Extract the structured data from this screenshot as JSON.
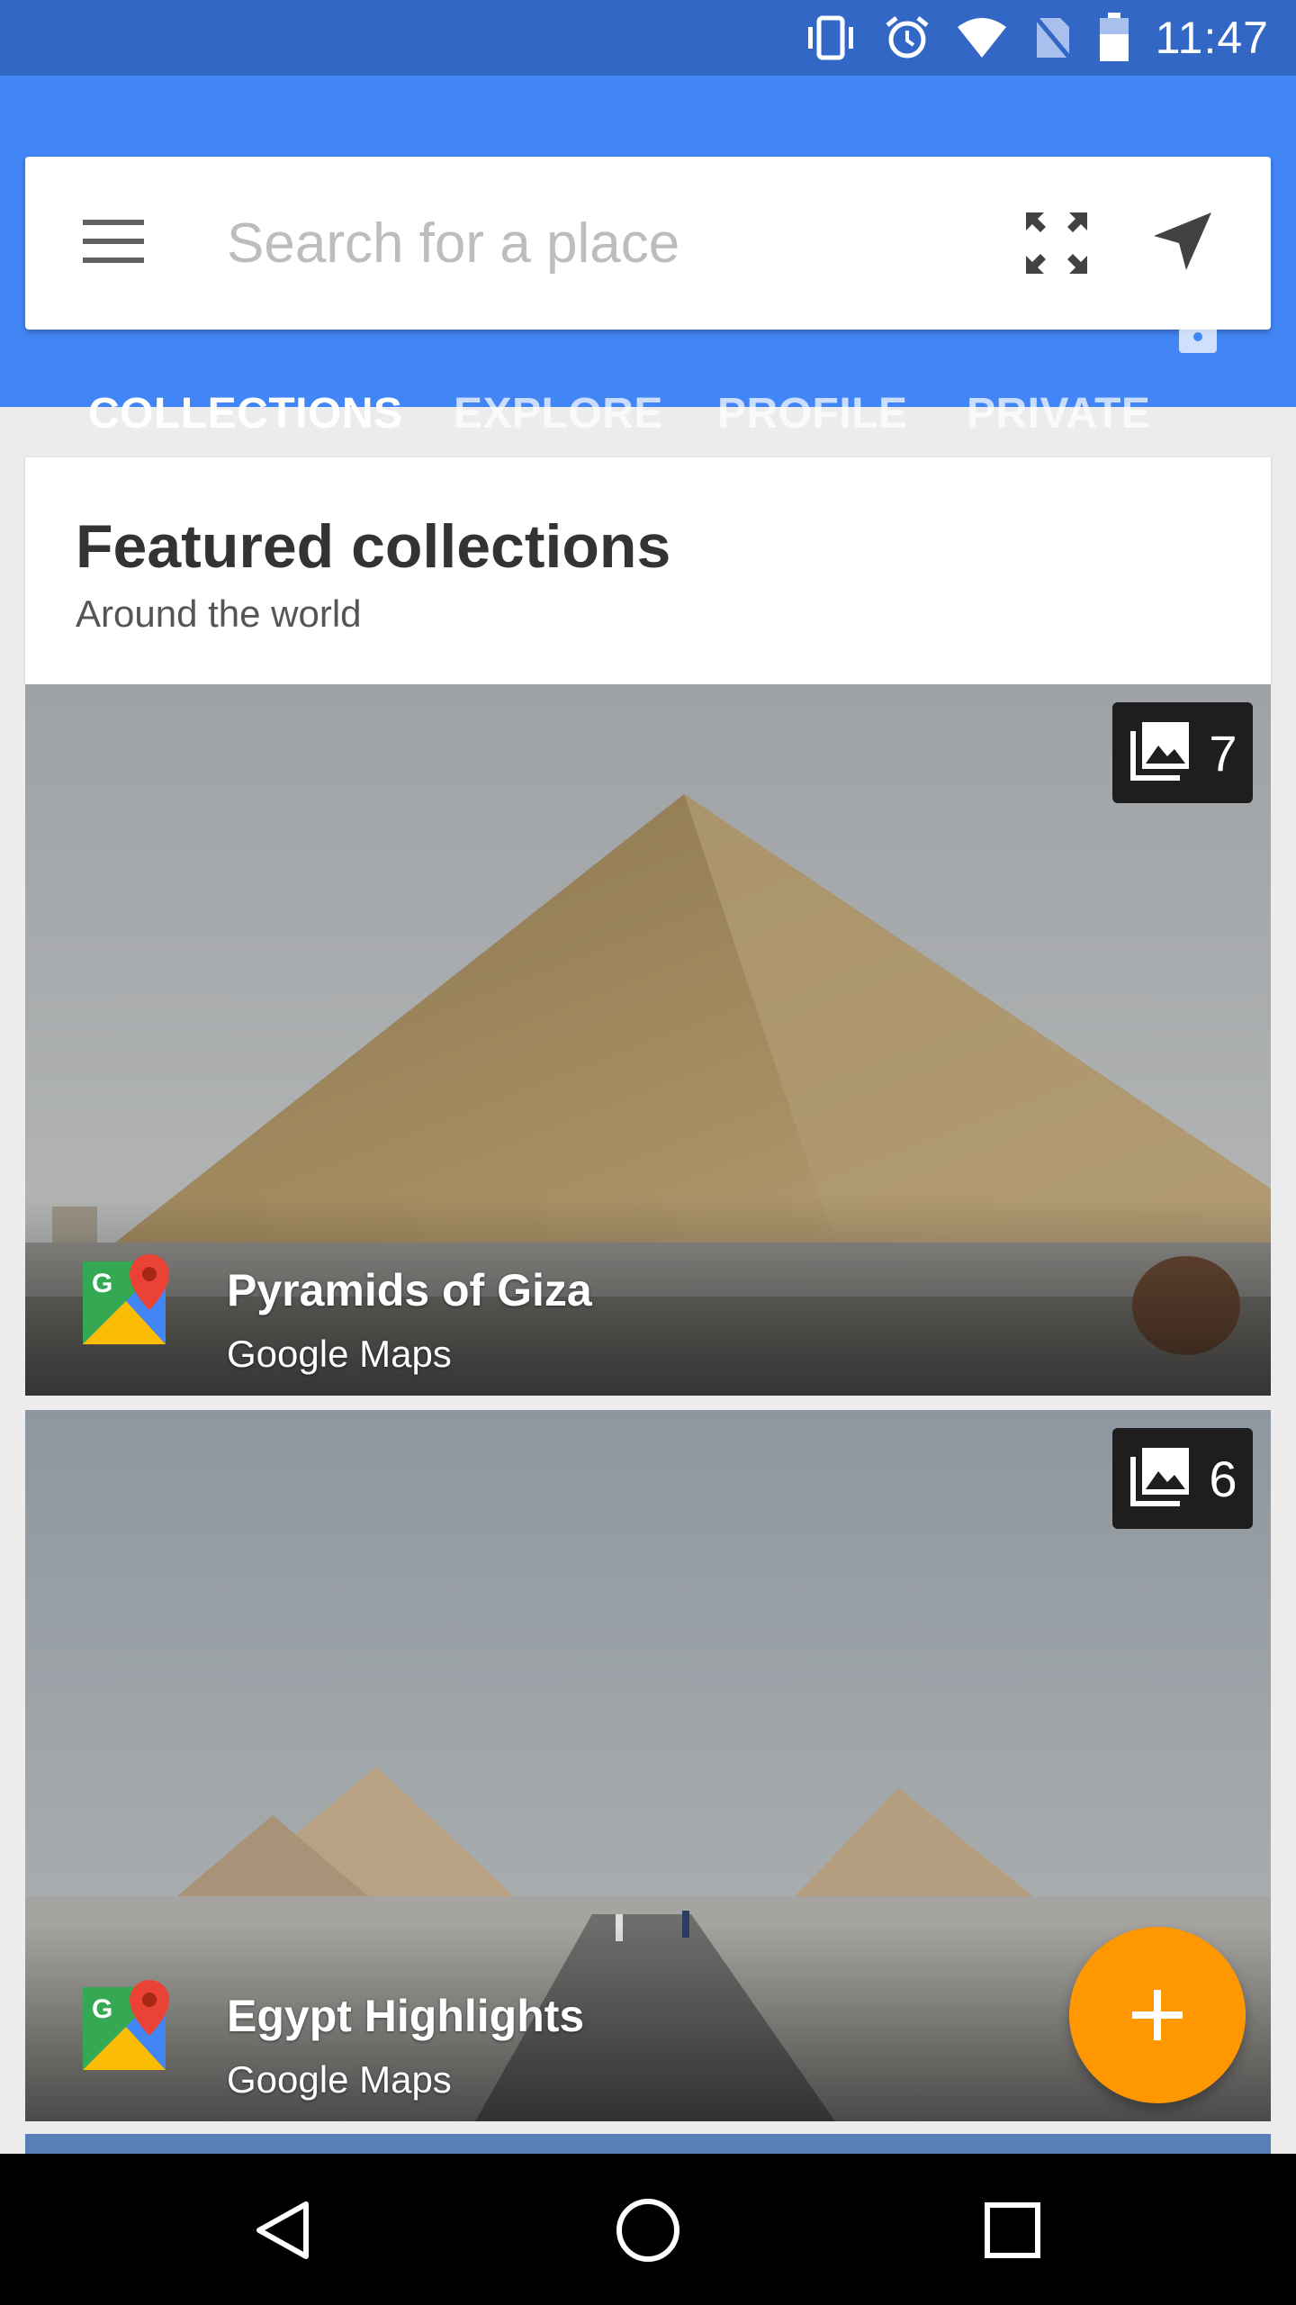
{
  "status_bar": {
    "time": "11:47",
    "icons": [
      "vibrate-icon",
      "alarm-icon",
      "wifi-icon",
      "no-sim-icon",
      "battery-icon"
    ]
  },
  "search": {
    "placeholder": "Search for a place",
    "value": ""
  },
  "tabs": [
    {
      "label": "COLLECTIONS",
      "active": true
    },
    {
      "label": "EXPLORE",
      "active": false
    },
    {
      "label": "PROFILE",
      "active": false
    },
    {
      "label": "PRIVATE",
      "active": false
    }
  ],
  "featured": {
    "title": "Featured collections",
    "subtitle": "Around the world"
  },
  "collections": [
    {
      "title": "Pyramids of Giza",
      "source": "Google Maps",
      "photo_count": "7"
    },
    {
      "title": "Egypt Highlights",
      "source": "Google Maps",
      "photo_count": "6"
    }
  ],
  "colors": {
    "status_bar": "#3367c6",
    "app_bar": "#4285f4",
    "fab": "#ff9800"
  }
}
